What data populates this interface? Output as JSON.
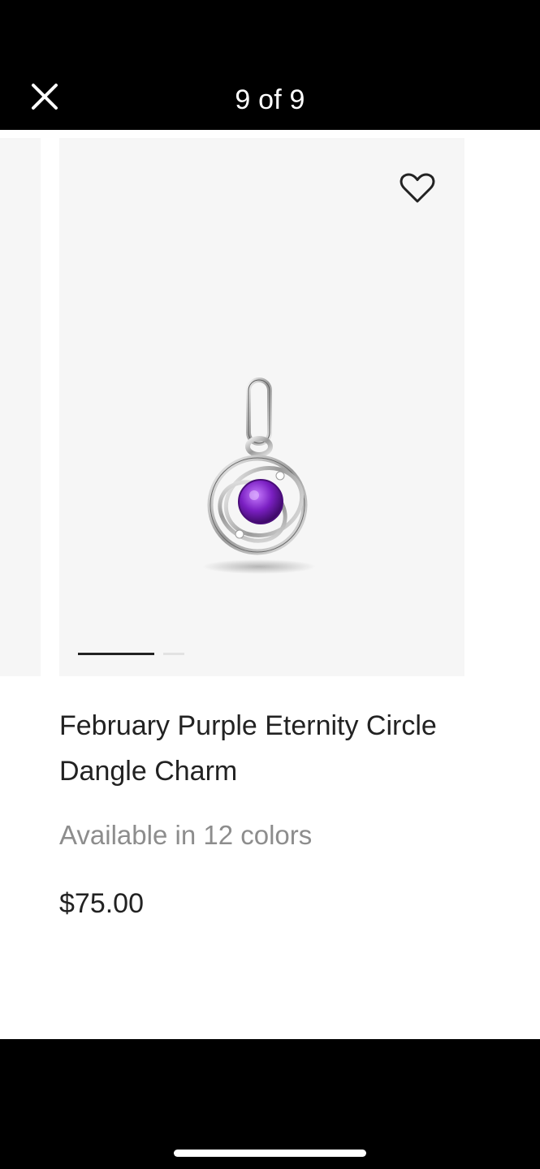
{
  "header": {
    "counter_text": "9 of 9",
    "close_icon": "close-icon"
  },
  "product": {
    "name": "February Purple Eternity Circle Dangle Charm",
    "availability": "Available in 12 colors",
    "price": "$75.00",
    "wishlist_icon": "heart-outline-icon",
    "gem_color": "#7a1fc2"
  },
  "carousel": {
    "image_count": 2,
    "active_image_index": 0
  }
}
